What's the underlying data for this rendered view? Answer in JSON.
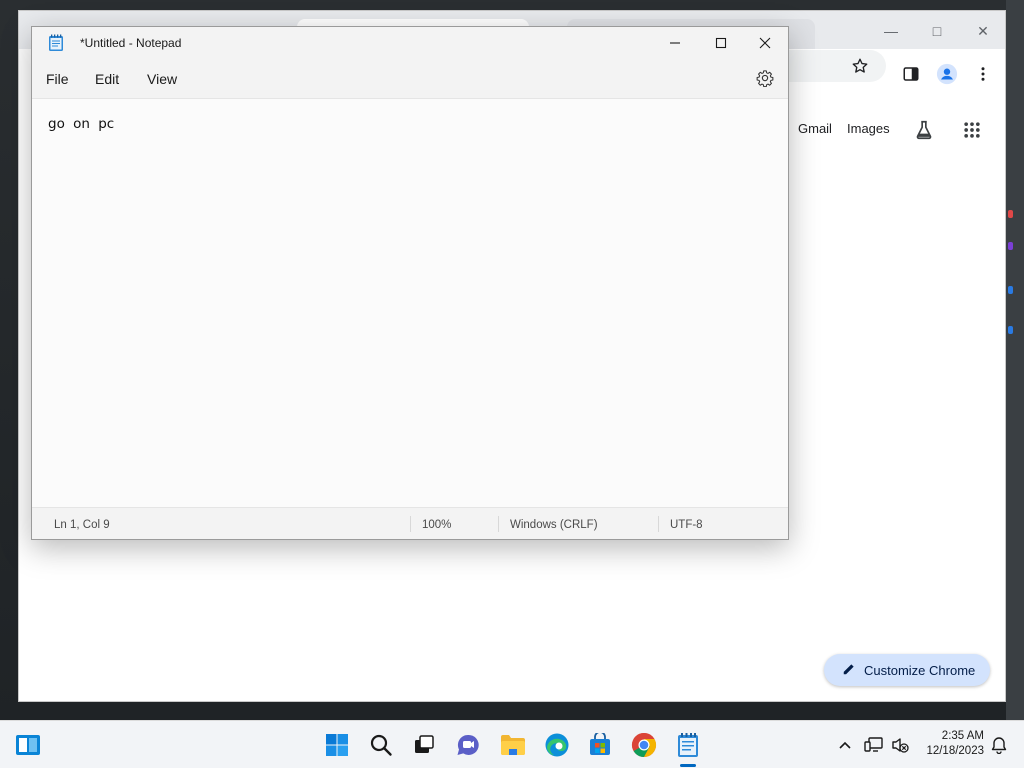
{
  "chrome": {
    "gmail_label": "Gmail",
    "images_label": "Images",
    "customize_label": "Customize Chrome",
    "minimize_glyph": "—",
    "maximize_glyph": "□",
    "close_glyph": "✕"
  },
  "notepad": {
    "title": "*Untitled - Notepad",
    "menu": {
      "file": "File",
      "edit": "Edit",
      "view": "View"
    },
    "content": "go on pc",
    "status": {
      "position": "Ln 1, Col 9",
      "zoom": "100%",
      "line_ending": "Windows (CRLF)",
      "encoding": "UTF-8"
    }
  },
  "taskbar": {
    "items": [
      {
        "name": "start",
        "icon": "windows-start-icon"
      },
      {
        "name": "search",
        "icon": "search-icon"
      },
      {
        "name": "task-view",
        "icon": "task-view-icon"
      },
      {
        "name": "chat",
        "icon": "teams-chat-icon"
      },
      {
        "name": "file-explorer",
        "icon": "folder-icon"
      },
      {
        "name": "edge",
        "icon": "edge-icon"
      },
      {
        "name": "store",
        "icon": "store-icon"
      },
      {
        "name": "chrome",
        "icon": "chrome-icon"
      },
      {
        "name": "notepad",
        "icon": "notepad-icon",
        "active": true
      }
    ],
    "time": "2:35 AM",
    "date": "12/18/2023"
  },
  "colors": {
    "accent": "#0067c0",
    "customize_bg": "#d3e3fd",
    "chrome_profile": "#1a73e8"
  }
}
